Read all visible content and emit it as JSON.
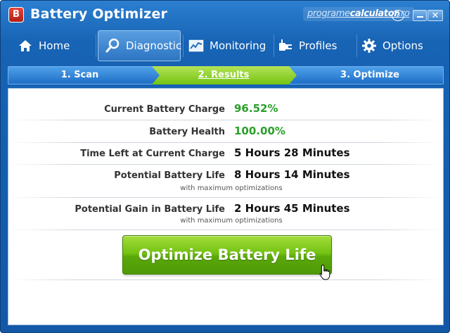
{
  "window": {
    "title": "Battery Optimizer",
    "logo_letter": "B",
    "watermark_part1": "programe",
    "watermark_part2": "calculator",
    "watermark_part3": ".ro",
    "help_label": "?",
    "close_label": "✕"
  },
  "nav": {
    "items": [
      {
        "label": "Home",
        "icon": "house-icon"
      },
      {
        "label": "Diagnostic",
        "icon": "magnifier-icon"
      },
      {
        "label": "Monitoring",
        "icon": "chart-icon"
      },
      {
        "label": "Profiles",
        "icon": "plug-icon"
      },
      {
        "label": "Options",
        "icon": "gear-icon"
      }
    ],
    "active": "Diagnostic"
  },
  "steps": {
    "items": [
      "1. Scan",
      "2. Results",
      "3. Optimize"
    ],
    "active": "2. Results"
  },
  "stats": {
    "charge_label": "Current Battery Charge",
    "charge_value": "96.52%",
    "health_label": "Battery Health",
    "health_value": "100.00%",
    "time_left_label": "Time Left at Current Charge",
    "time_left_value": "5 Hours 28 Minutes",
    "potential_label": "Potential Battery Life",
    "potential_value": "8 Hours 14 Minutes",
    "potential_sub": "with maximum optimizations",
    "gain_label": "Potential Gain in Battery Life",
    "gain_value": "2 Hours 45 Minutes",
    "gain_sub": "with maximum optimizations"
  },
  "actions": {
    "optimize_label": "Optimize Battery Life"
  },
  "colors": {
    "accent_blue": "#1763b4",
    "good_green": "#2aa02a",
    "button_green": "#74c313",
    "step_active": "#8ccf1f"
  }
}
